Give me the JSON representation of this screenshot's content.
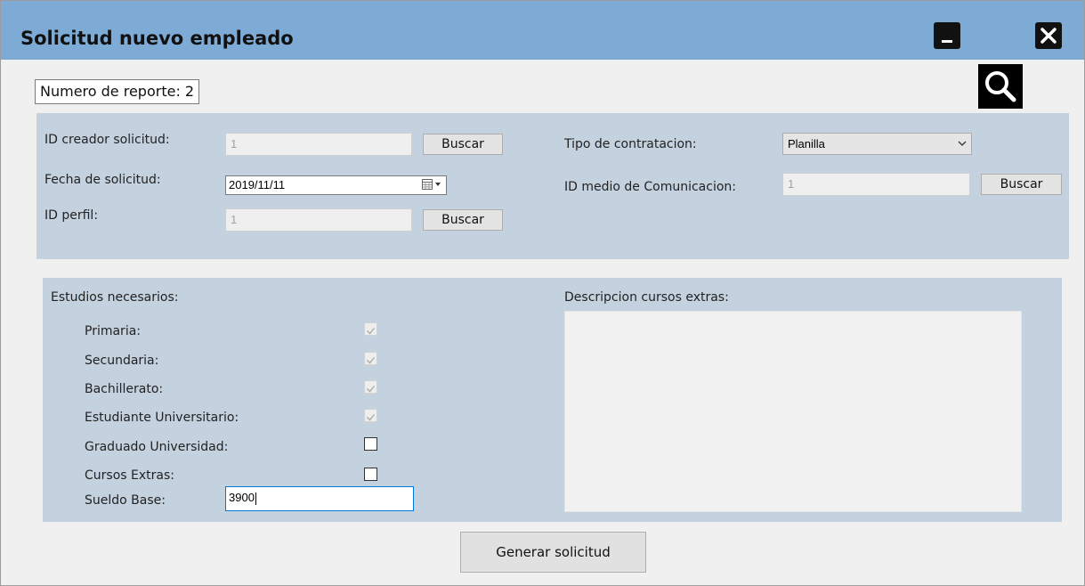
{
  "window": {
    "title": "Solicitud nuevo empleado",
    "minimize_icon": "minimize-icon",
    "close_icon": "close-icon"
  },
  "report": {
    "label": "Numero de reporte: 2",
    "search_icon": "magnifier-icon"
  },
  "top_panel": {
    "creator": {
      "label": "ID creador solicitud:",
      "value": "1",
      "button": "Buscar"
    },
    "date": {
      "label": "Fecha de solicitud:",
      "value": "2019/11/11",
      "icon": "calendar-dropdown-icon"
    },
    "profile": {
      "label": "ID perfil:",
      "value": "1",
      "button": "Buscar"
    },
    "contract_type": {
      "label": "Tipo de contratacion:",
      "value": "Planilla",
      "icon": "chevron-down-icon"
    },
    "medium": {
      "label": "ID medio de Comunicacion:",
      "value": "1",
      "button": "Buscar"
    }
  },
  "studies": {
    "heading": "Estudios necesarios:",
    "items": [
      {
        "label": "Primaria:",
        "checked": true,
        "enabled": false
      },
      {
        "label": "Secundaria:",
        "checked": true,
        "enabled": false
      },
      {
        "label": "Bachillerato:",
        "checked": true,
        "enabled": false
      },
      {
        "label": "Estudiante Universitario:",
        "checked": true,
        "enabled": false
      },
      {
        "label": "Graduado Universidad:",
        "checked": false,
        "enabled": true
      },
      {
        "label": "Cursos Extras:",
        "checked": false,
        "enabled": true
      }
    ],
    "salary": {
      "label": "Sueldo Base:",
      "value": "3900"
    }
  },
  "courses": {
    "label": "Descripcion cursos extras:",
    "value": ""
  },
  "generate_button": "Generar solicitud",
  "colors": {
    "titlebar": "#7eaad6",
    "panel": "#c4d1df",
    "focus": "#0078d7"
  }
}
